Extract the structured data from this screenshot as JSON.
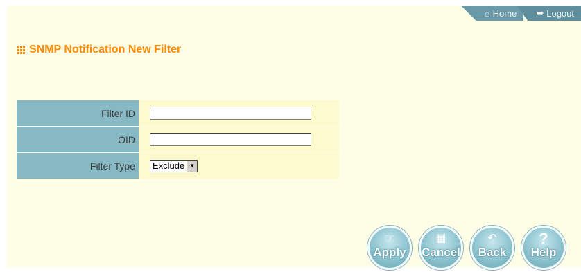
{
  "topnav": {
    "home_label": "Home",
    "home_icon": "home-icon",
    "logout_label": "Logout",
    "logout_icon": "logout-icon"
  },
  "page": {
    "title": "SNMP Notification New Filter",
    "title_icon": "grid-bullet-icon"
  },
  "form": {
    "filter_id_label": "Filter ID",
    "filter_id_value": "",
    "oid_label": "OID",
    "oid_value": "",
    "filter_type_label": "Filter Type",
    "filter_type_value": "Exclude"
  },
  "buttons": {
    "apply": "Apply",
    "cancel": "Cancel",
    "back": "Back",
    "help": "Help"
  },
  "colors": {
    "title": "#ff8a00",
    "label_bg": "#87b9c4",
    "field_bg": "#fdfbce",
    "page_bg": "#fefde6",
    "nav_bg": "#6a9aa7"
  }
}
